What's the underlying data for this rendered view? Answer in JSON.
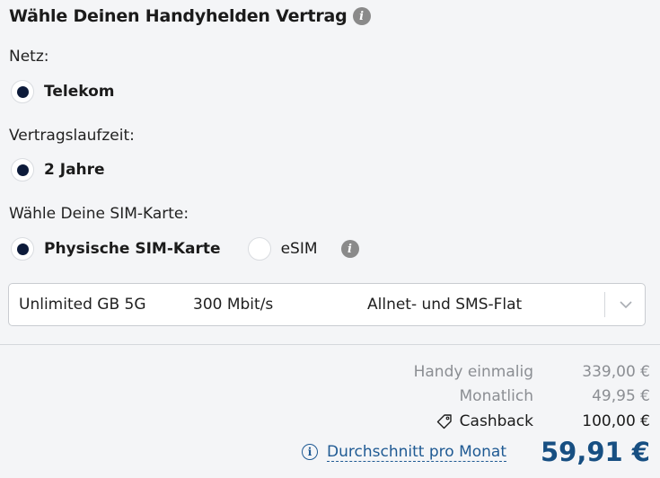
{
  "header": {
    "title": "Wähle Deinen Handyhelden Vertrag",
    "info_icon": "info-icon"
  },
  "network": {
    "label": "Netz:",
    "options": [
      {
        "label": "Telekom",
        "selected": true
      }
    ]
  },
  "term": {
    "label": "Vertragslaufzeit:",
    "options": [
      {
        "label": "2 Jahre",
        "selected": true
      }
    ]
  },
  "sim": {
    "label": "Wähle Deine SIM-Karte:",
    "options": [
      {
        "label": "Physische SIM-Karte",
        "selected": true
      },
      {
        "label": "eSIM",
        "selected": false
      }
    ],
    "info_icon": "info-icon"
  },
  "tariff": {
    "data": "Unlimited GB 5G",
    "speed": "300 Mbit/s",
    "flat": "Allnet- und SMS-Flat",
    "icon": "chevron-down-icon"
  },
  "summary": {
    "one_time_label": "Handy einmalig",
    "one_time_value": "339,00 €",
    "monthly_label": "Monatlich",
    "monthly_value": "49,95 €",
    "cashback_label": "Cashback",
    "cashback_value": "100,00 €",
    "average_label": "Durchschnitt pro Monat",
    "average_value": "59,91 €"
  },
  "colors": {
    "radio_fill": "#0d1b3a",
    "accent": "#1f5a93",
    "price": "#174f82",
    "background": "#f4f5f7"
  }
}
